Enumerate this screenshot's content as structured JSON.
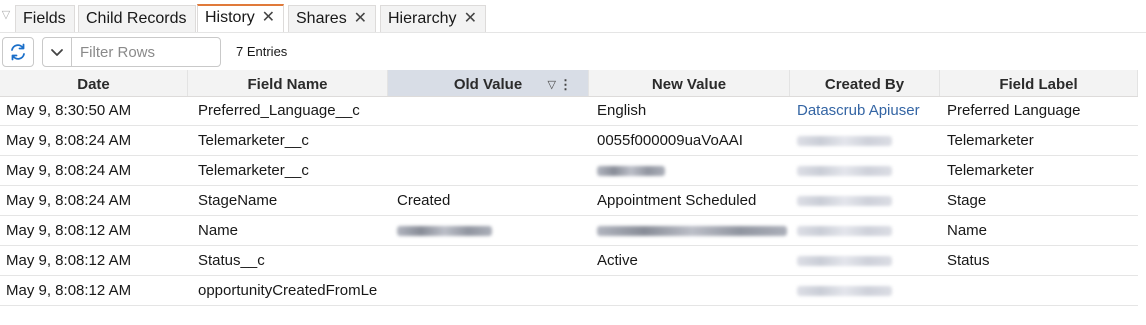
{
  "tabs": [
    {
      "label": "Fields",
      "closable": false
    },
    {
      "label": "Child Records",
      "closable": false
    },
    {
      "label": "History",
      "closable": true,
      "active": true
    },
    {
      "label": "Shares",
      "closable": true
    },
    {
      "label": "Hierarchy",
      "closable": true
    }
  ],
  "icons": {
    "tab_overflow": "chevron-down-icon",
    "refresh": "refresh-icon",
    "menu": "chevron-down-icon",
    "close": "close-icon",
    "column_filter": "filter-icon",
    "column_menu": "more-vertical-icon"
  },
  "toolbar": {
    "filter_placeholder": "Filter Rows",
    "entries": "7 Entries"
  },
  "columns": [
    "Date",
    "Field Name",
    "Old Value",
    "New Value",
    "Created By",
    "Field Label"
  ],
  "rows": [
    {
      "date": "May 9, 8:30:50 AM",
      "field_name": "Preferred_Language__c",
      "old_value": "",
      "new_value": "English",
      "created_by": "Datascrub Apiuser",
      "field_label": "Preferred Language"
    },
    {
      "date": "May 9, 8:08:24 AM",
      "field_name": "Telemarketer__c",
      "old_value": "",
      "new_value": "0055f000009uaVoAAI",
      "created_by": "",
      "field_label": "Telemarketer"
    },
    {
      "date": "May 9, 8:08:24 AM",
      "field_name": "Telemarketer__c",
      "old_value": "",
      "new_value": "",
      "created_by": "",
      "field_label": "Telemarketer"
    },
    {
      "date": "May 9, 8:08:24 AM",
      "field_name": "StageName",
      "old_value": "Created",
      "new_value": "Appointment Scheduled",
      "created_by": "",
      "field_label": "Stage"
    },
    {
      "date": "May 9, 8:08:12 AM",
      "field_name": "Name",
      "old_value": "",
      "new_value": "",
      "created_by": "",
      "field_label": "Name"
    },
    {
      "date": "May 9, 8:08:12 AM",
      "field_name": "Status__c",
      "old_value": "",
      "new_value": "Active",
      "created_by": "",
      "field_label": "Status"
    },
    {
      "date": "May 9, 8:08:12 AM",
      "field_name": "opportunityCreatedFromLe",
      "old_value": "",
      "new_value": "",
      "created_by": "",
      "field_label": ""
    }
  ],
  "colors": {
    "active_tab_accent": "#e07a3a",
    "link": "#3465a4",
    "sorted_header": "#d8dde6"
  }
}
